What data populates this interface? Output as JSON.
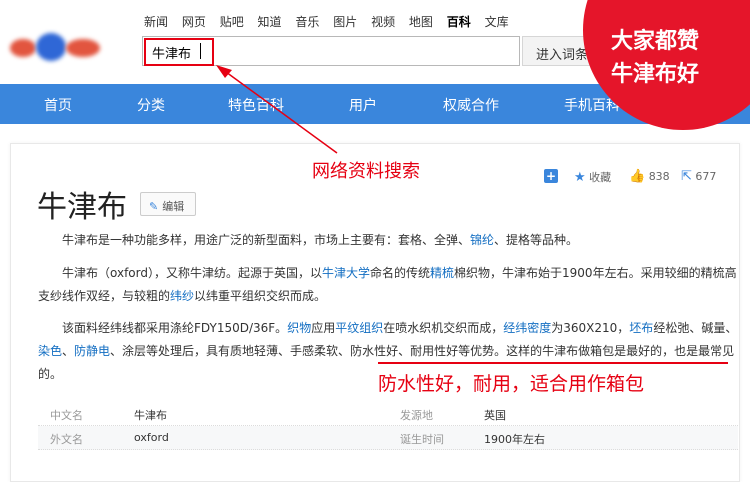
{
  "header": {
    "nav_links": [
      "新闻",
      "网页",
      "贴吧",
      "知道",
      "音乐",
      "图片",
      "视频",
      "地图",
      "百科",
      "文库"
    ],
    "active_link": "百科",
    "search_value": "牛津布",
    "enter_button": "进入词条"
  },
  "blue_nav": [
    "首页",
    "分类",
    "特色百科",
    "用户",
    "权威合作",
    "手机百科"
  ],
  "badge": {
    "line1": "大家都赞",
    "line2": "牛津布好"
  },
  "annotation_search": "网络资料搜索",
  "toolbar": {
    "collect": "收藏",
    "likes": "838",
    "shares": "677"
  },
  "article": {
    "title": "牛津布",
    "edit_label": "编辑",
    "para1": {
      "pre": "牛津布是一种功能多样，用途广泛的新型面料，市场上主要有：套格、全弹、",
      "link1": "锦纶",
      "post": "、提格等品种。"
    },
    "para2": {
      "t1": "牛津布（oxford），又称牛津纺。起源于英国，以",
      "l1": "牛津大学",
      "t2": "命名的传统",
      "l2": "精梳",
      "t3": "棉织物，牛津布始于1900年左右。采用较细的精梳高支纱线作双经，与较粗的",
      "l3": "纬纱",
      "t4": "以纬重平组织交织而成。"
    },
    "para3": {
      "t1": "该面料经纬线都采用涤纶FDY150D/36F。",
      "l1": "织物",
      "t2": "应用",
      "l2": "平纹组织",
      "t3": "在喷水织机交织而成，",
      "l3": "经纬密度",
      "t4": "为360X210，",
      "l4": "坯布",
      "t5": "经松弛、碱量、",
      "l5": "染色",
      "t6": "、",
      "l6": "防静电",
      "t7": "、涂层等处理后，具有质地轻薄、手感柔软、",
      "u1": "防水性好、耐用性好等优势。这样的牛津布做箱包是最好的",
      "t8": "，也是最常见的。"
    }
  },
  "annotation_bottom": "防水性好，耐用，适合用作箱包",
  "infobox": {
    "rows": [
      {
        "k1": "中文名",
        "v1": "牛津布",
        "k2": "发源地",
        "v2": "英国"
      },
      {
        "k1": "外文名",
        "v1": "oxford",
        "k2": "诞生时间",
        "v2": "1900年左右"
      }
    ]
  },
  "colors": {
    "accent_blue": "#3a86dc",
    "annotation_red": "#e60012",
    "link": "#136ec2"
  },
  "icons": [
    "plus-icon",
    "star-icon",
    "thumbs-up-icon",
    "share-icon",
    "pencil-icon"
  ]
}
